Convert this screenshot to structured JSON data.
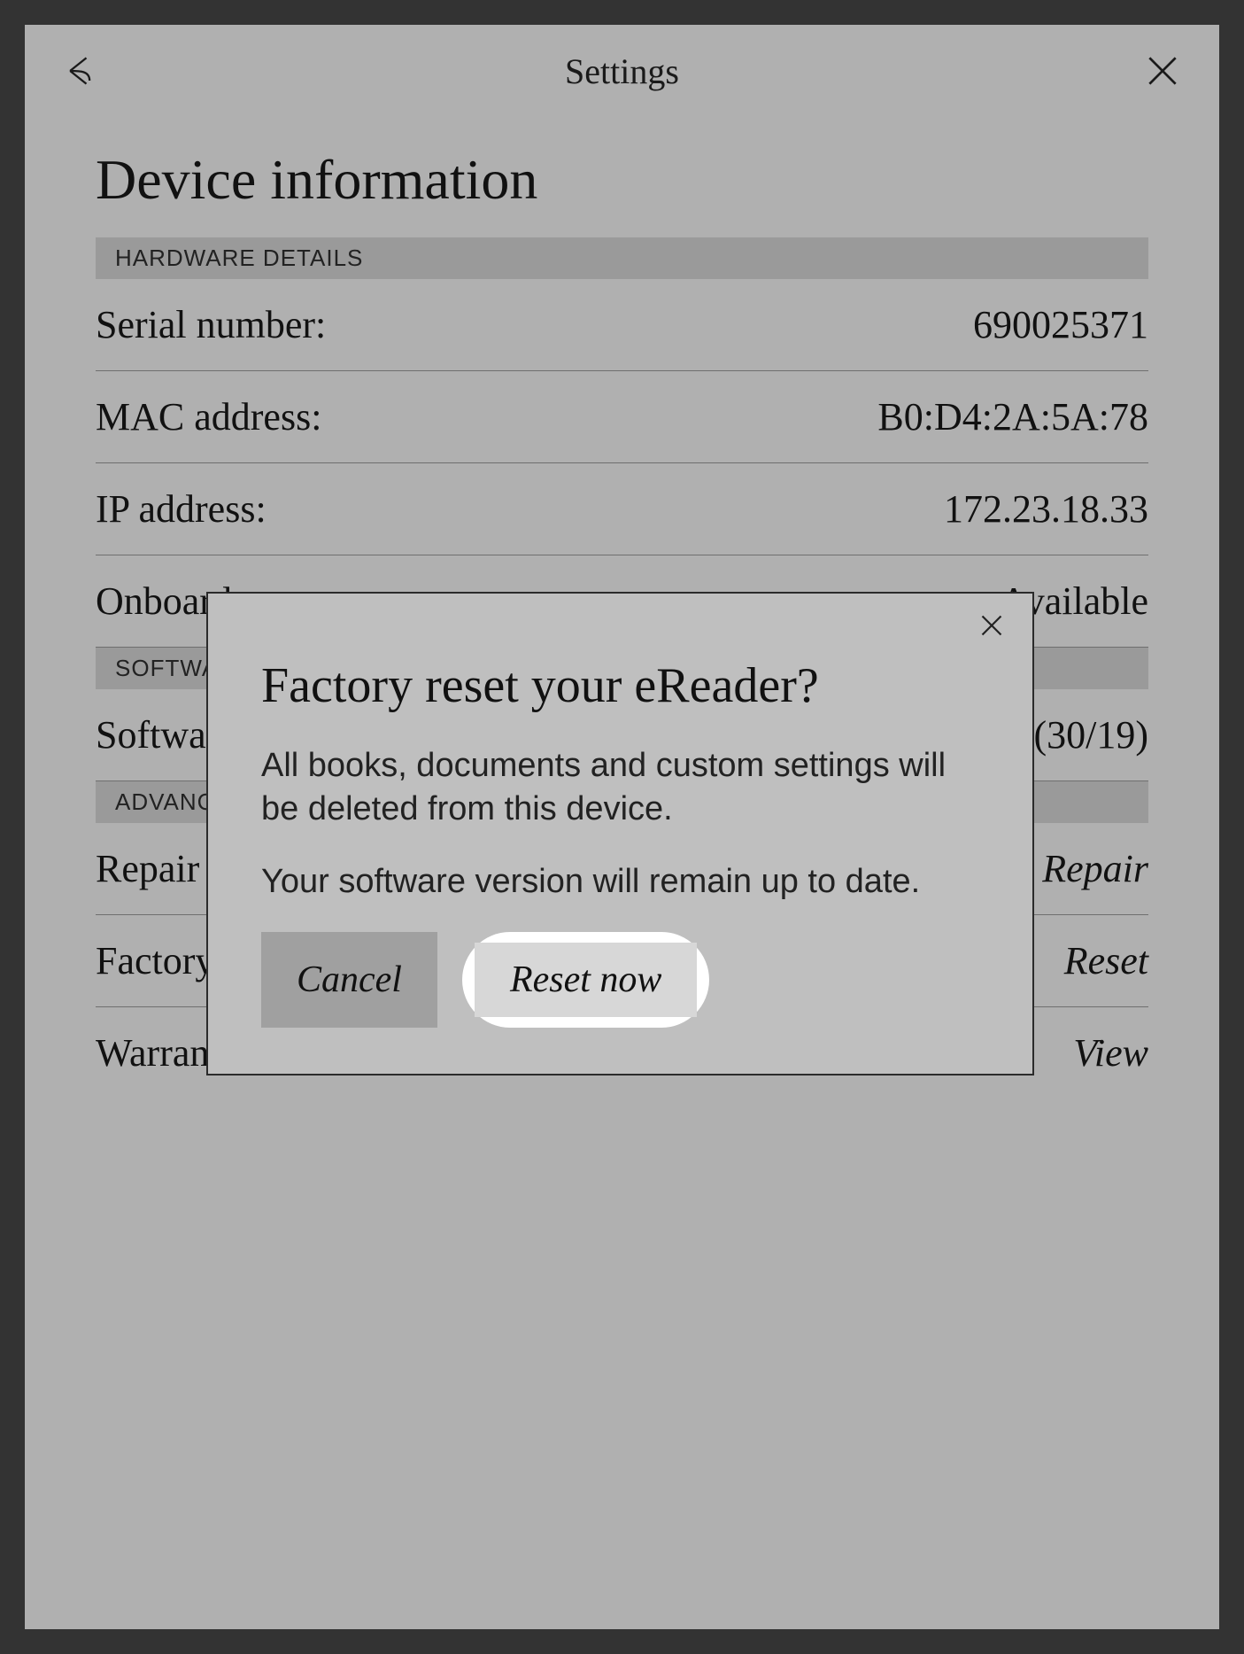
{
  "header": {
    "title": "Settings"
  },
  "page": {
    "title": "Device information"
  },
  "sections": {
    "hardware": {
      "header": "HARDWARE DETAILS"
    },
    "software": {
      "header": "SOFTWARE DETAILS"
    },
    "advanced": {
      "header": "ADVANCED"
    }
  },
  "rows": {
    "serial": {
      "label": "Serial number:",
      "value": "690025371"
    },
    "mac": {
      "label": "MAC address:",
      "value": "B0:D4:2A:5A:78"
    },
    "ip": {
      "label": "IP address:",
      "value": "172.23.18.33"
    },
    "storage": {
      "label": "Onboard storage:",
      "value": "Available"
    },
    "swver": {
      "label": "Software version:",
      "value": "(30/19)"
    },
    "repair": {
      "label": "Repair account:",
      "action": "Repair"
    },
    "factory": {
      "label": "Factory reset:",
      "action": "Reset"
    },
    "warranty": {
      "label": "Warranty & Legal:",
      "action": "View"
    }
  },
  "modal": {
    "title": "Factory reset your eReader?",
    "line1": "All books, documents and custom settings will be deleted from this device.",
    "line2": "Your software version will remain up to date.",
    "cancel": "Cancel",
    "reset": "Reset now"
  }
}
